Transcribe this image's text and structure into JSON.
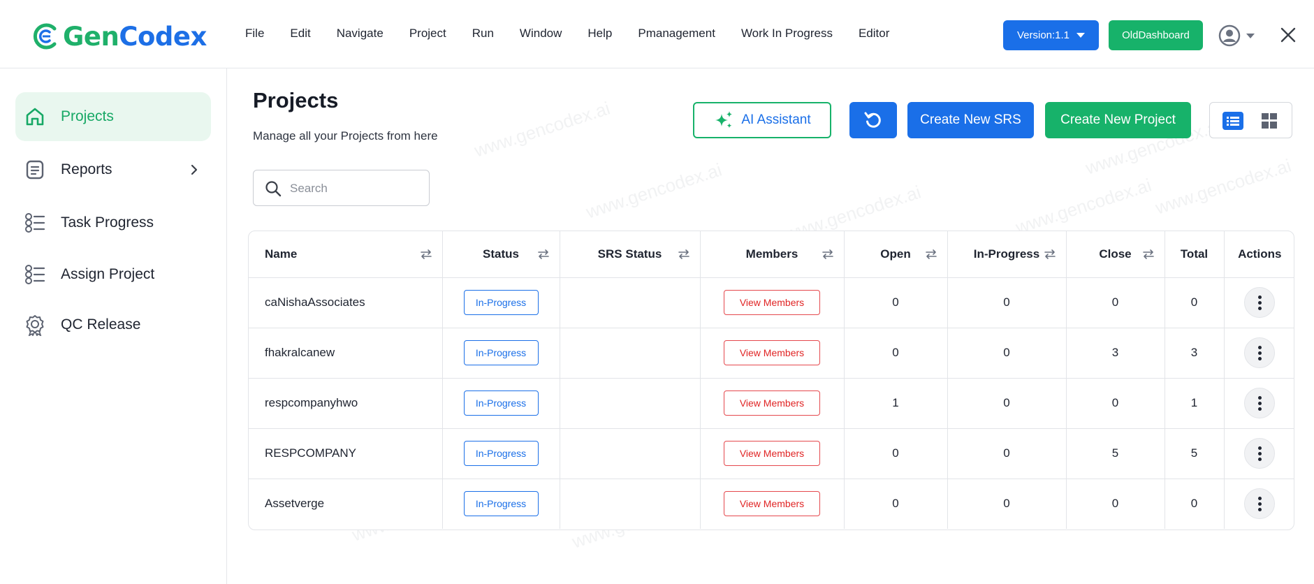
{
  "app": {
    "logo_text_part1": "Gen",
    "logo_text_part2": "Codex",
    "watermark": "www.gencodex.ai"
  },
  "menu": [
    "File",
    "Edit",
    "Navigate",
    "Project",
    "Run",
    "Window",
    "Help",
    "Pmanagement",
    "Work In Progress",
    "Editor"
  ],
  "header": {
    "version_label": "Version:1.1",
    "old_dashboard_label": "OldDashboard"
  },
  "sidebar": {
    "items": [
      {
        "label": "Projects",
        "icon": "home-icon",
        "active": true
      },
      {
        "label": "Reports",
        "icon": "report-icon",
        "has_submenu": true
      },
      {
        "label": "Task Progress",
        "icon": "task-list-icon"
      },
      {
        "label": "Assign Project",
        "icon": "assign-list-icon"
      },
      {
        "label": "QC Release",
        "icon": "badge-icon"
      }
    ]
  },
  "main": {
    "title": "Projects",
    "subtitle": "Manage all your Projects from here",
    "search_placeholder": "Search",
    "ai_assistant_label": "AI Assistant",
    "create_srs_label": "Create New SRS",
    "create_project_label": "Create New Project"
  },
  "table": {
    "columns": [
      "Name",
      "Status",
      "SRS Status",
      "Members",
      "Open",
      "In-Progress",
      "Close",
      "Total",
      "Actions"
    ],
    "members_button_label": "View Members",
    "rows": [
      {
        "name": "caNishaAssociates",
        "status": "In-Progress",
        "srs_status": "",
        "open": "0",
        "in_progress": "0",
        "close": "0",
        "total": "0"
      },
      {
        "name": "fhakralcanew",
        "status": "In-Progress",
        "srs_status": "",
        "open": "0",
        "in_progress": "0",
        "close": "3",
        "total": "3"
      },
      {
        "name": "respcompanyhwo",
        "status": "In-Progress",
        "srs_status": "",
        "open": "1",
        "in_progress": "0",
        "close": "0",
        "total": "1"
      },
      {
        "name": "RESPCOMPANY",
        "status": "In-Progress",
        "srs_status": "",
        "open": "0",
        "in_progress": "0",
        "close": "5",
        "total": "5"
      },
      {
        "name": "Assetverge",
        "status": "In-Progress",
        "srs_status": "",
        "open": "0",
        "in_progress": "0",
        "close": "0",
        "total": "0"
      }
    ]
  },
  "colors": {
    "brand_green": "#17b26a",
    "brand_blue": "#1a6fe8",
    "danger_red": "#e02424"
  }
}
